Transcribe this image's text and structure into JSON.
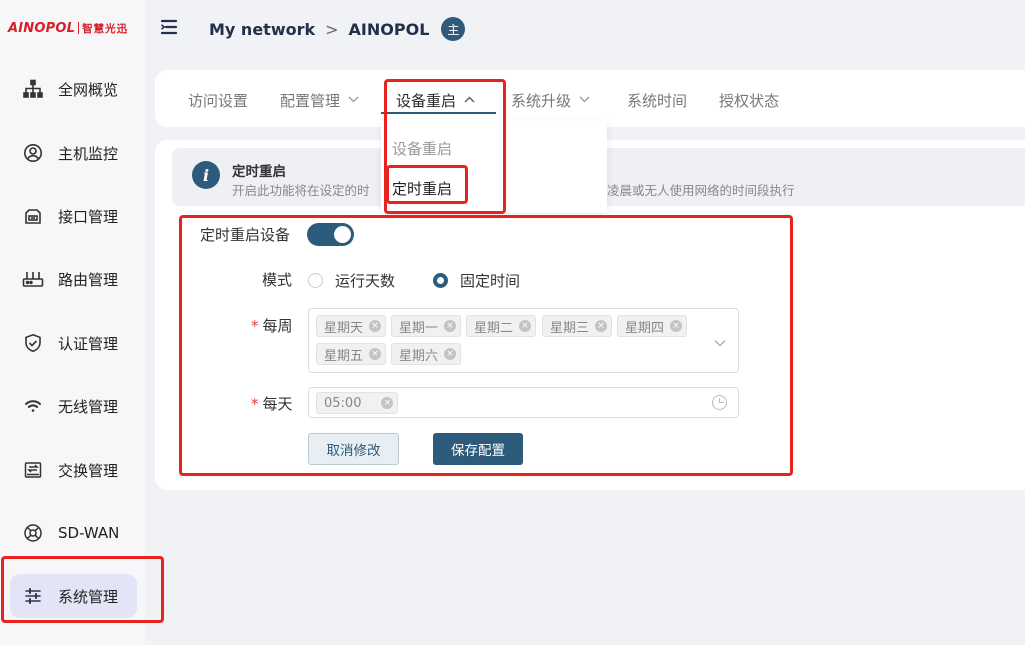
{
  "brand": {
    "name_en": "AINOPOL",
    "name_cn": "智慧光迅"
  },
  "sidebar": {
    "items": [
      {
        "label": "全网概览",
        "icon": "network-topology-icon"
      },
      {
        "label": "主机监控",
        "icon": "user-circle-icon"
      },
      {
        "label": "接口管理",
        "icon": "interface-icon"
      },
      {
        "label": "路由管理",
        "icon": "router-icon"
      },
      {
        "label": "认证管理",
        "icon": "shield-icon"
      },
      {
        "label": "无线管理",
        "icon": "wifi-icon"
      },
      {
        "label": "交换管理",
        "icon": "switch-icon"
      },
      {
        "label": "SD-WAN",
        "icon": "sdwan-icon"
      },
      {
        "label": "系统管理",
        "icon": "sliders-icon",
        "active": true
      }
    ]
  },
  "header": {
    "breadcrumb": [
      "My network",
      "AINOPOL"
    ],
    "separator": ">",
    "avatar_text": "主"
  },
  "tabs": [
    {
      "label": "访问设置",
      "has_dropdown": false
    },
    {
      "label": "配置管理",
      "has_dropdown": true
    },
    {
      "label": "设备重启",
      "has_dropdown": true,
      "active": true
    },
    {
      "label": "系统升级",
      "has_dropdown": true
    },
    {
      "label": "系统时间",
      "has_dropdown": false
    },
    {
      "label": "授权状态",
      "has_dropdown": false
    }
  ],
  "dropdown": {
    "items": [
      {
        "label": "设备重启"
      },
      {
        "label": "定时重启",
        "selected": true
      }
    ]
  },
  "info": {
    "title": "定时重启",
    "description_left": "开启此功能将在设定的时",
    "description_right": "在凌晨或无人使用网络的时间段执行"
  },
  "form": {
    "enable_label": "定时重启设备",
    "enabled": true,
    "mode_label": "模式",
    "mode_options": [
      {
        "label": "运行天数",
        "checked": false
      },
      {
        "label": "固定时间",
        "checked": true
      }
    ],
    "weekly_label": "每周",
    "weekdays": [
      "星期天",
      "星期一",
      "星期二",
      "星期三",
      "星期四",
      "星期五",
      "星期六"
    ],
    "daily_label": "每天",
    "time_value": "05:00",
    "cancel_label": "取消修改",
    "save_label": "保存配置"
  },
  "colors": {
    "accent": "#2d5b7b",
    "brand": "#d8202a",
    "highlight": "#e8231e",
    "required": "#e23b3b"
  }
}
